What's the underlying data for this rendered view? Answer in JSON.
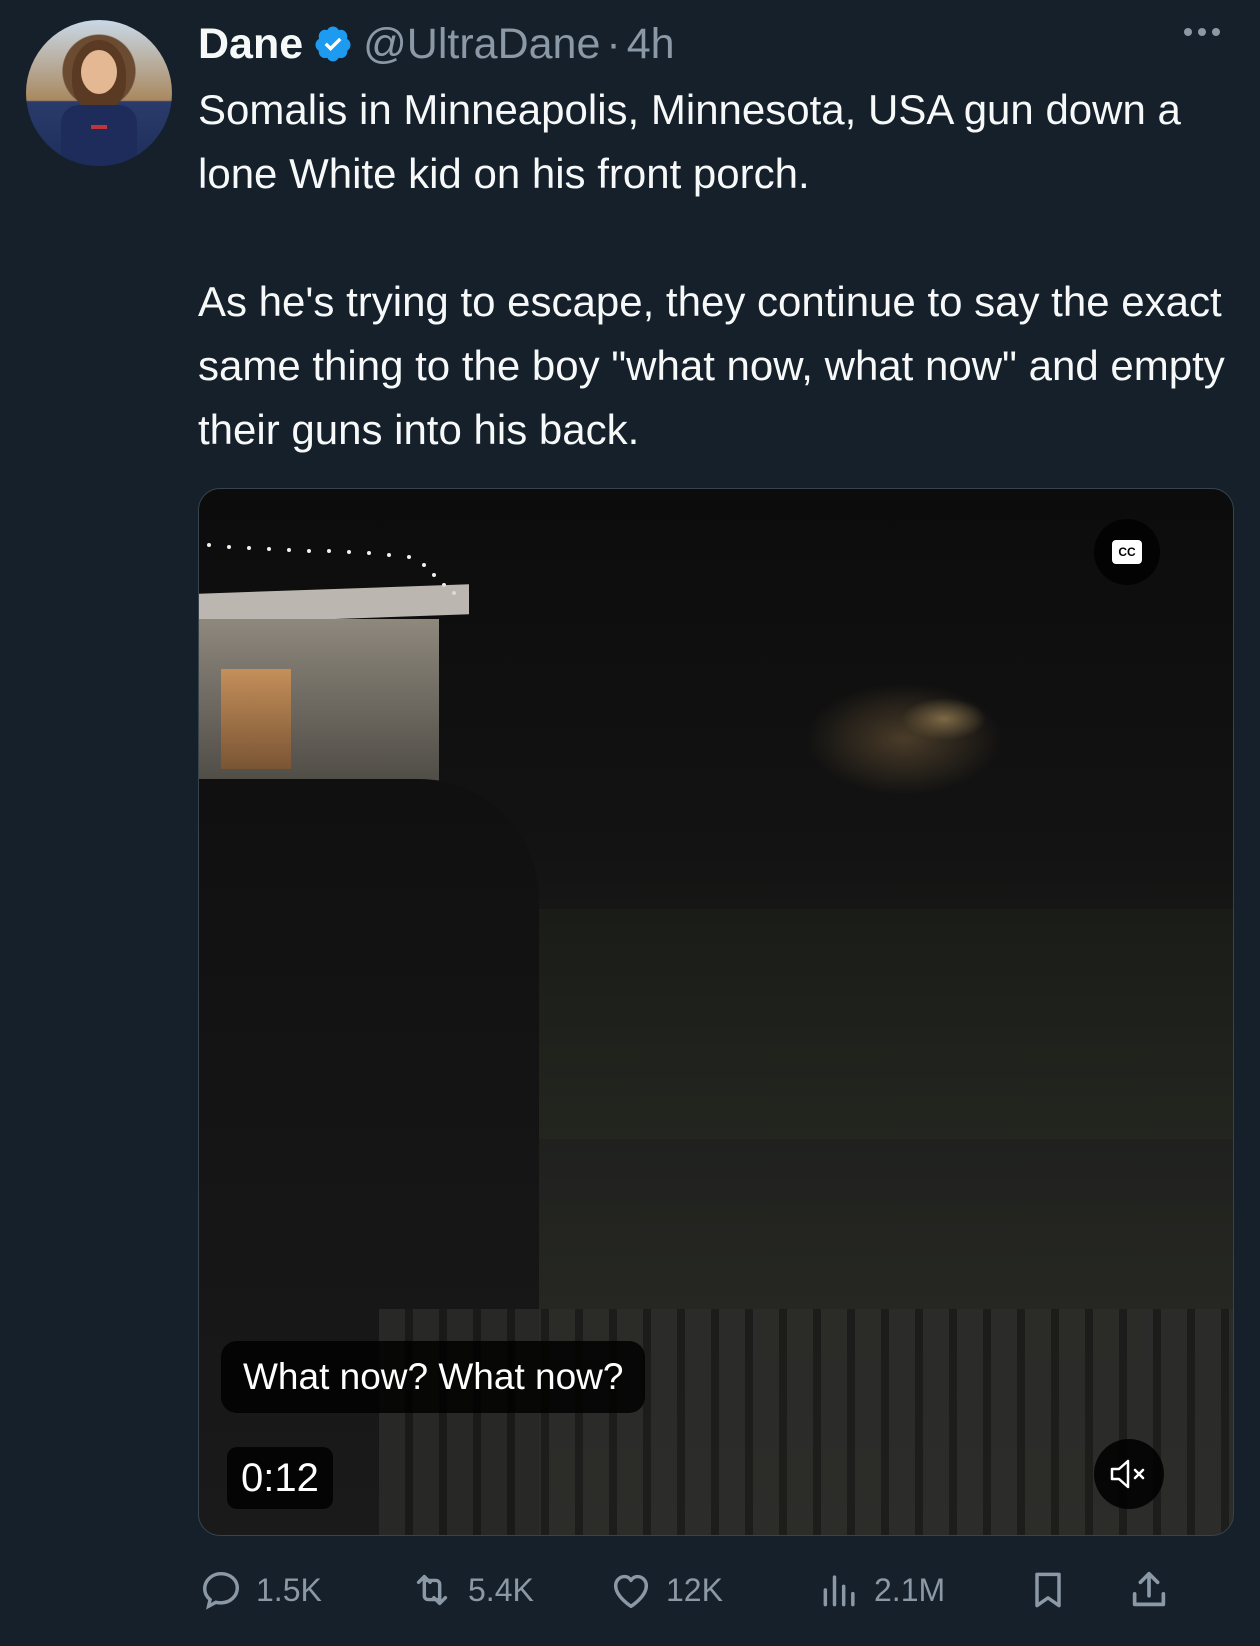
{
  "tweet": {
    "author_name": "Dane",
    "handle": "@UltraDane",
    "separator": "·",
    "time": "4h",
    "verified_color": "#1d9bf0",
    "text_paragraphs": [
      "Somalis in Minneapolis, Minnesota, USA gun down a lone White kid on his front porch.",
      "As he's trying to escape, they continue to say the exact same thing to the boy \"what now, what now\" and empty their guns into his back."
    ]
  },
  "video": {
    "caption": "What now? What now?",
    "timestamp": "0:12",
    "cc_icon": "closed-captions-icon",
    "mute_icon": "speaker-muted-icon"
  },
  "actions": {
    "replies": "1.5K",
    "reposts": "5.4K",
    "likes": "12K",
    "views": "2.1M"
  },
  "colors": {
    "background": "#15202b",
    "text": "#f7f9f9",
    "muted": "#8b98a5"
  }
}
